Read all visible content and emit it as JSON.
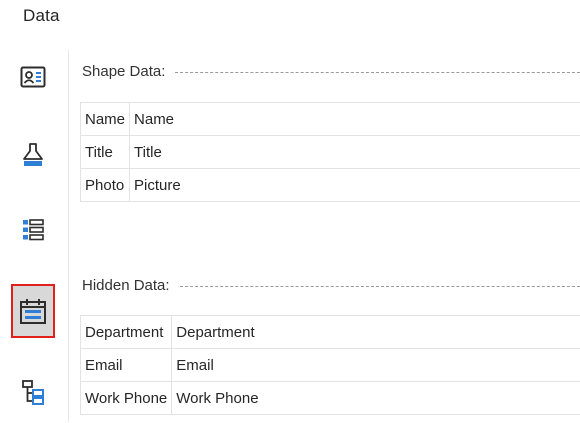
{
  "panel": {
    "title": "Data"
  },
  "sidebar": {
    "items": [
      {
        "name": "shape-data",
        "icon": "contact-card-icon",
        "color": "#2d2d2d"
      },
      {
        "name": "style",
        "icon": "paint-brush-icon",
        "color": "#2f7fd6"
      },
      {
        "name": "list",
        "icon": "list-icon",
        "color": "#2f7fd6"
      },
      {
        "name": "data-fields",
        "icon": "calendar-table-icon",
        "color": "#2f7fd6",
        "selected": true
      },
      {
        "name": "hierarchy",
        "icon": "hierarchy-tree-icon",
        "color": "#2d2d2d"
      }
    ]
  },
  "shape_data": {
    "label": "Shape Data:",
    "rows": [
      {
        "key": "Name",
        "value": "Name"
      },
      {
        "key": "Title",
        "value": "Title"
      },
      {
        "key": "Photo",
        "value": "Picture"
      }
    ]
  },
  "hidden_data": {
    "label": "Hidden Data:",
    "rows": [
      {
        "key": "Department",
        "value": "Department"
      },
      {
        "key": "Email",
        "value": "Email"
      },
      {
        "key": "Work Phone",
        "value": "Work Phone"
      }
    ]
  },
  "colors": {
    "accent_blue": "#2f7fd6",
    "selection_border": "#e0201c",
    "selection_fill": "#d8d8d8"
  }
}
